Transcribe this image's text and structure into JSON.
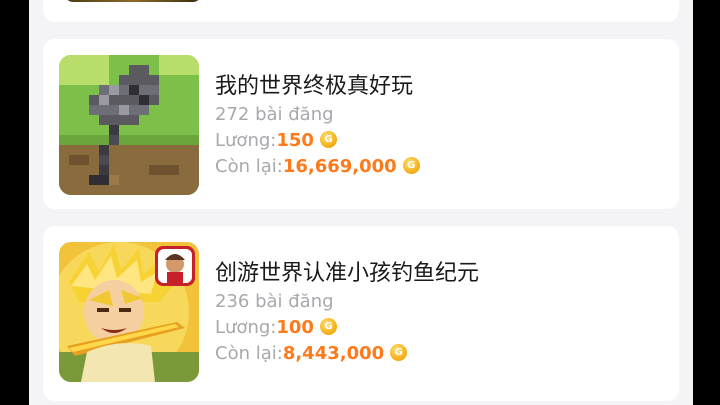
{
  "games": [
    {
      "title": "我的世界终极真好玩",
      "posts": "272 bài đăng",
      "salary_label": "Lương:",
      "salary_value": "150",
      "remaining_label": "Còn lại:",
      "remaining_value": "16,669,000",
      "icon": "pixel-mace-icon"
    },
    {
      "title": "创游世界认准小孩钓鱼纪元",
      "posts": "236 bài đăng",
      "salary_label": "Lương:",
      "salary_value": "100",
      "remaining_label": "Còn lại:",
      "remaining_value": "8,443,000",
      "icon": "anime-hero-icon"
    }
  ],
  "colors": {
    "accent": "#ff7a1a",
    "muted": "#a8a8ad",
    "background": "#f4f4f6",
    "card": "#ffffff",
    "coin": "#f6b21c"
  }
}
